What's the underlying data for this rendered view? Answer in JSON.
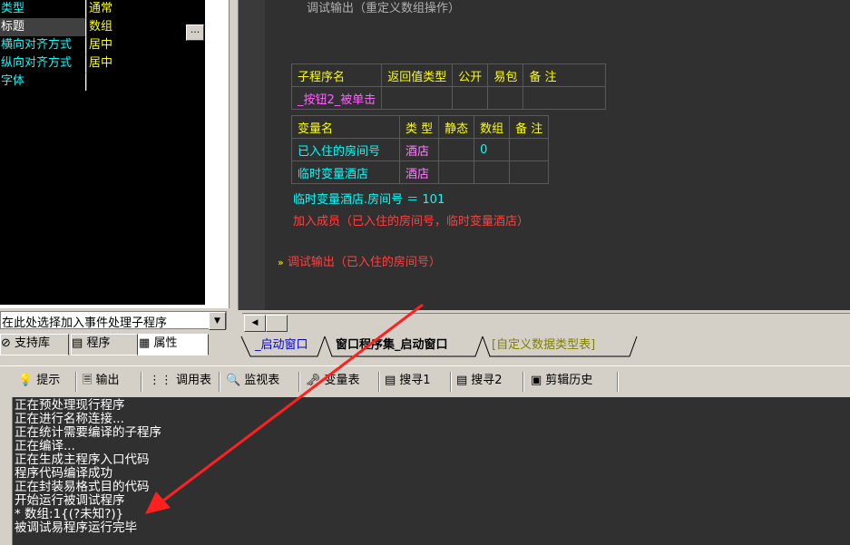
{
  "properties": [
    {
      "name": "类型",
      "value": "通常"
    },
    {
      "name": "标题",
      "value": "数组"
    },
    {
      "name": "横向对齐方式",
      "value": "居中"
    },
    {
      "name": "纵向对齐方式",
      "value": "居中"
    },
    {
      "name": "字体",
      "value": ""
    }
  ],
  "ellipsis_label": "...",
  "event_select": {
    "placeholder": "在此处选择加入事件处理子程序"
  },
  "left_tabs": [
    {
      "label": "支持库"
    },
    {
      "label": "程序"
    },
    {
      "label": "属性"
    }
  ],
  "code": {
    "comment": "调试输出（重定义数组操作）",
    "sub_table": {
      "headers": [
        "子程序名",
        "返回值类型",
        "公开",
        "易包",
        "备 注"
      ],
      "row": {
        "name": "_按钮2_被单击"
      }
    },
    "var_table": {
      "headers": [
        "变量名",
        "类 型",
        "静态",
        "数组",
        "备 注"
      ],
      "rows": [
        {
          "name": "已入住的房间号",
          "type": "酒店",
          "array": "0"
        },
        {
          "name": "临时变量酒店",
          "type": "酒店",
          "array": ""
        }
      ]
    },
    "line1": "临时变量酒店.房间号 ＝ 101",
    "line2": "加入成员（已入住的房间号，临时变量酒店）",
    "line3_marker": "»",
    "line3": "调试输出（已入住的房间号）"
  },
  "file_tabs": [
    {
      "label": "_启动窗口"
    },
    {
      "label": "窗口程序集_启动窗口"
    },
    {
      "label": "[自定义数据类型表]"
    }
  ],
  "output_tabs": [
    {
      "label": "提示"
    },
    {
      "label": "输出"
    },
    {
      "label": "调用表"
    },
    {
      "label": "监视表"
    },
    {
      "label": "变量表"
    },
    {
      "label": "搜寻1"
    },
    {
      "label": "搜寻2"
    },
    {
      "label": "剪辑历史"
    }
  ],
  "log_lines": [
    "正在预处理现行程序",
    "正在进行名称连接...",
    "正在统计需要编译的子程序",
    "正在编译...",
    "正在生成主程序入口代码",
    "程序代码编译成功",
    "正在封装易格式目的代码",
    "开始运行被调试程序",
    "* 数组:1{(?未知?)}",
    "被调试易程序运行完毕"
  ],
  "colors": {
    "code_bg": "#303030",
    "keyword_yellow": "#ffff00",
    "name_cyan": "#00ffff",
    "type_magenta": "#ff80ff",
    "call_red": "#ff4040",
    "arrow_red": "#ff2020"
  }
}
